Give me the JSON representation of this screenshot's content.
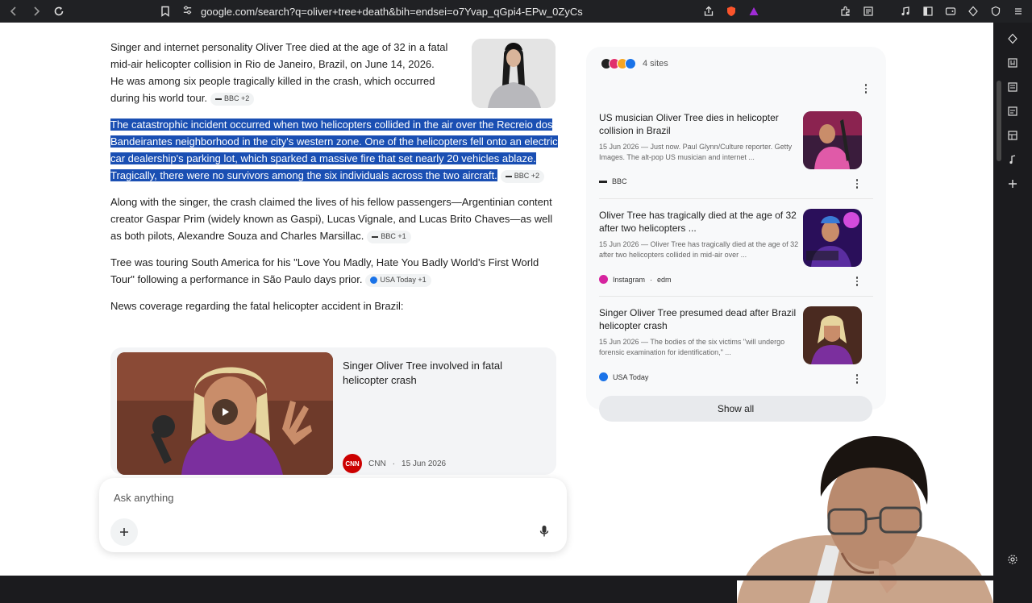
{
  "browser": {
    "url": "google.com/search?q=oliver+tree+death&bih=endsei=o7Yvap_qGpi4-EPw_0ZyCs",
    "accent": "#1a73e8"
  },
  "article": {
    "para1": "Singer and internet personality Oliver Tree died at the age of 32 in a fatal mid-air helicopter collision in Rio de Janeiro, Brazil, on June 14, 2026. He was among six people tragically killed in the crash, which occurred during his world tour.",
    "para1_chip": "BBC +2",
    "para2": "The catastrophic incident occurred when two helicopters collided in the air over the Recreio dos Bandeirantes neighborhood in the city's western zone. One of the helicopters fell onto an electric car dealership's parking lot, which sparked a massive fire that set nearly 20 vehicles ablaze. Tragically, there were no survivors among the six individuals across the two aircraft.",
    "para2_chip": "BBC +2",
    "para3": "Along with the singer, the crash claimed the lives of his fellow passengers—Argentinian content creator Gaspar Prim (widely known as Gaspi), Lucas Vignale, and Lucas Brito Chaves—as well as both pilots, Alexandre Souza and Charles Marsillac.",
    "para3_chip": "BBC +1",
    "para4": "Tree was touring South America for his \"Love You Madly, Hate You Badly World's First World Tour\" following a performance in São Paulo days prior.",
    "para4_chip": "USA Today +1",
    "para5": "News coverage regarding the fatal helicopter accident in Brazil:",
    "video": {
      "title": "Singer Oliver Tree involved in fatal helicopter crash",
      "source_logo": "CNN",
      "source": "CNN",
      "date": "15 Jun 2026"
    }
  },
  "ask": {
    "placeholder": "Ask anything"
  },
  "sites": {
    "count_label": "4 sites",
    "items": [
      {
        "title": "US musician Oliver Tree dies in helicopter collision in Brazil",
        "snippet": "15 Jun 2026 — Just now. Paul Glynn/Culture reporter. Getty Images. The alt-pop US musician and internet ...",
        "source": "BBC"
      },
      {
        "title": "Oliver Tree has tragically died at the age of 32 after two helicopters ...",
        "snippet": "15 Jun 2026 — Oliver Tree has tragically died at the age of 32 after two helicopters collided in mid-air over ...",
        "source": "Instagram",
        "source_extra": "edm"
      },
      {
        "title": "Singer Oliver Tree presumed dead after Brazil helicopter crash",
        "snippet": "15 Jun 2026 — The bodies of the six victims \"will undergo forensic examination for identification,\" ...",
        "source": "USA Today"
      }
    ],
    "show_all": "Show all"
  }
}
